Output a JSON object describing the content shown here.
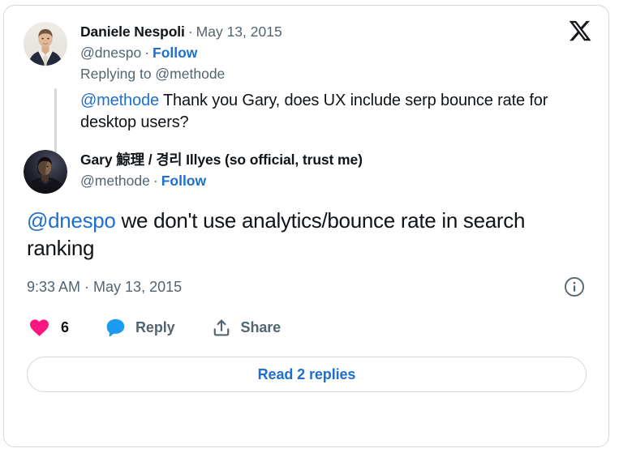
{
  "card": {
    "brand_logo": "x-logo",
    "accent_color": "#1d6fd0",
    "like_color": "#f91880",
    "reply_color": "#1d9bf0",
    "text_color": "#0f1419",
    "muted_color": "#536471",
    "border_color": "#cfd9de"
  },
  "reply_tweet": {
    "author": {
      "display_name": "Daniele Nespoli",
      "handle": "@dnespo",
      "avatar": "avatar-man-in-suit"
    },
    "separator": "·",
    "date": "May 13, 2015",
    "follow_label": "Follow",
    "replying_to_prefix": "Replying to ",
    "replying_to_handle": "@methode",
    "body_mention": "@methode",
    "body_text": " Thank you Gary, does UX include serp bounce rate for desktop users?"
  },
  "main_tweet": {
    "author": {
      "display_name": "Gary 鯨理 / 경리 Illyes (so official, trust me)",
      "handle": "@methode",
      "avatar": "avatar-dark-portrait"
    },
    "separator": "·",
    "follow_label": "Follow",
    "body_mention": "@dnespo",
    "body_text": " we don't use analytics/bounce rate in search ranking",
    "timestamp": "9:33 AM · May 13, 2015",
    "info_icon": "info-circle-icon"
  },
  "actions": {
    "like": {
      "icon": "heart-icon",
      "count": "6"
    },
    "reply": {
      "icon": "comment-bubble-icon",
      "label": "Reply"
    },
    "share": {
      "icon": "share-upload-icon",
      "label": "Share"
    }
  },
  "footer": {
    "read_replies_label": "Read 2 replies"
  }
}
